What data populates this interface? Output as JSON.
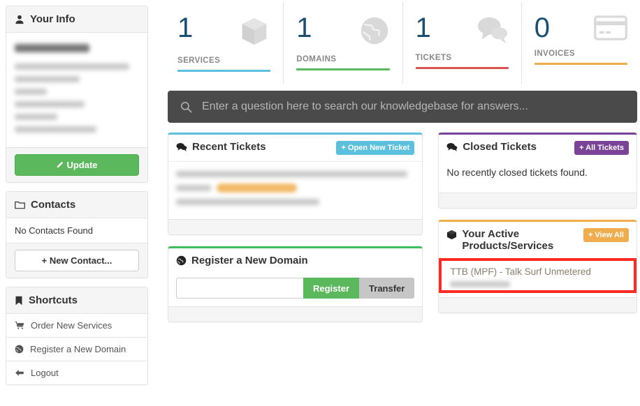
{
  "sidebar": {
    "your_info": {
      "title": "Your Info",
      "icon": "user-icon",
      "update_label": "Update",
      "update_icon": "pencil-icon",
      "redacted_lines": 7
    },
    "contacts": {
      "title": "Contacts",
      "icon": "folder-icon",
      "empty_text": "No Contacts Found",
      "new_contact_label": "+ New Contact..."
    },
    "shortcuts": {
      "title": "Shortcuts",
      "icon": "bookmark-icon",
      "items": [
        {
          "label": "Order New Services",
          "icon": "cart-icon"
        },
        {
          "label": "Register a New Domain",
          "icon": "globe-icon"
        },
        {
          "label": "Logout",
          "icon": "arrow-left-icon"
        }
      ]
    }
  },
  "stats": [
    {
      "value": "1",
      "label": "SERVICES",
      "icon": "box-icon",
      "color": "#5bc0de"
    },
    {
      "value": "1",
      "label": "DOMAINS",
      "icon": "globe-icon",
      "color": "#5cb85c"
    },
    {
      "value": "1",
      "label": "TICKETS",
      "icon": "comments-icon",
      "color": "#d9534f"
    },
    {
      "value": "0",
      "label": "INVOICES",
      "icon": "creditcard-icon",
      "color": "#f0ad4e"
    }
  ],
  "search": {
    "placeholder": "Enter a question here to search our knowledgebase for answers...",
    "value": "",
    "icon": "search-icon"
  },
  "cards": {
    "recent_tickets": {
      "title": "Recent Tickets",
      "icon": "comments-icon",
      "accent": "#5bc0de",
      "action_label": "+ Open New Ticket",
      "redacted_rows": 3
    },
    "closed_tickets": {
      "title": "Closed Tickets",
      "icon": "comments-icon",
      "accent": "#7b4397",
      "action_label": "+ All Tickets",
      "empty_text": "No recently closed tickets found."
    },
    "register_domain": {
      "title": "Register a New Domain",
      "icon": "globe-icon",
      "accent": "#3dbd5c",
      "input_value": "",
      "register_label": "Register",
      "transfer_label": "Transfer"
    },
    "active_products": {
      "title": "Your Active Products/Services",
      "icon": "box-icon",
      "accent": "#f0ad4e",
      "action_label": "+ View All",
      "highlight_color": "#ff2a23",
      "items": [
        {
          "name": "TTB (MPF) - Talk Surf Unmetered",
          "detail_redacted": true
        }
      ]
    }
  }
}
